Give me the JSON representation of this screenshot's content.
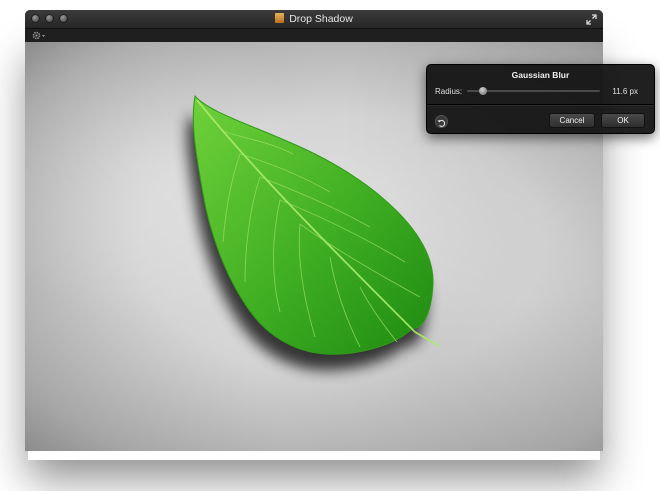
{
  "window": {
    "title": "Drop Shadow"
  },
  "toolbar": {
    "gear_icon": "gear-icon"
  },
  "hud": {
    "title": "Gaussian Blur",
    "radius_label": "Radius:",
    "radius_value": "11.6 px",
    "slider_level": 0.12,
    "cancel_label": "Cancel",
    "ok_label": "OK"
  },
  "colors": {
    "leaf_light": "#6fd13a",
    "leaf_dark": "#1e8a12",
    "vein": "#a8ea6a"
  }
}
